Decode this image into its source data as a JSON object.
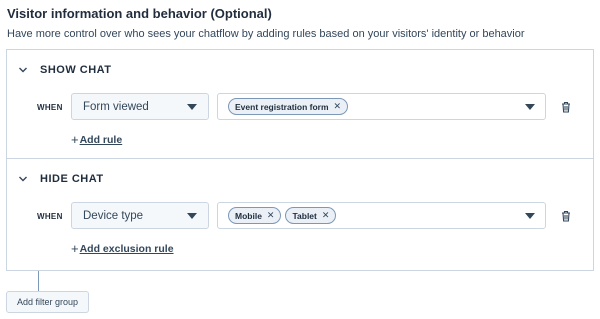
{
  "section": {
    "title": "Visitor information and behavior (Optional)",
    "description": "Have more control over who sees your chatflow by adding rules based on your visitors' identity or behavior"
  },
  "groups": [
    {
      "title": "SHOW CHAT",
      "when_label": "WHEN",
      "property": "Form viewed",
      "tags": [
        "Event registration form"
      ],
      "add_label": "Add rule"
    },
    {
      "title": "HIDE CHAT",
      "when_label": "WHEN",
      "property": "Device type",
      "tags": [
        "Mobile",
        "Tablet"
      ],
      "add_label": "Add exclusion rule"
    }
  ],
  "add_filter_group_label": "Add filter group",
  "icons": {
    "collapse": "chevron-down-icon",
    "remove_tag": "close-icon",
    "delete": "trash-icon",
    "add": "plus-icon"
  }
}
